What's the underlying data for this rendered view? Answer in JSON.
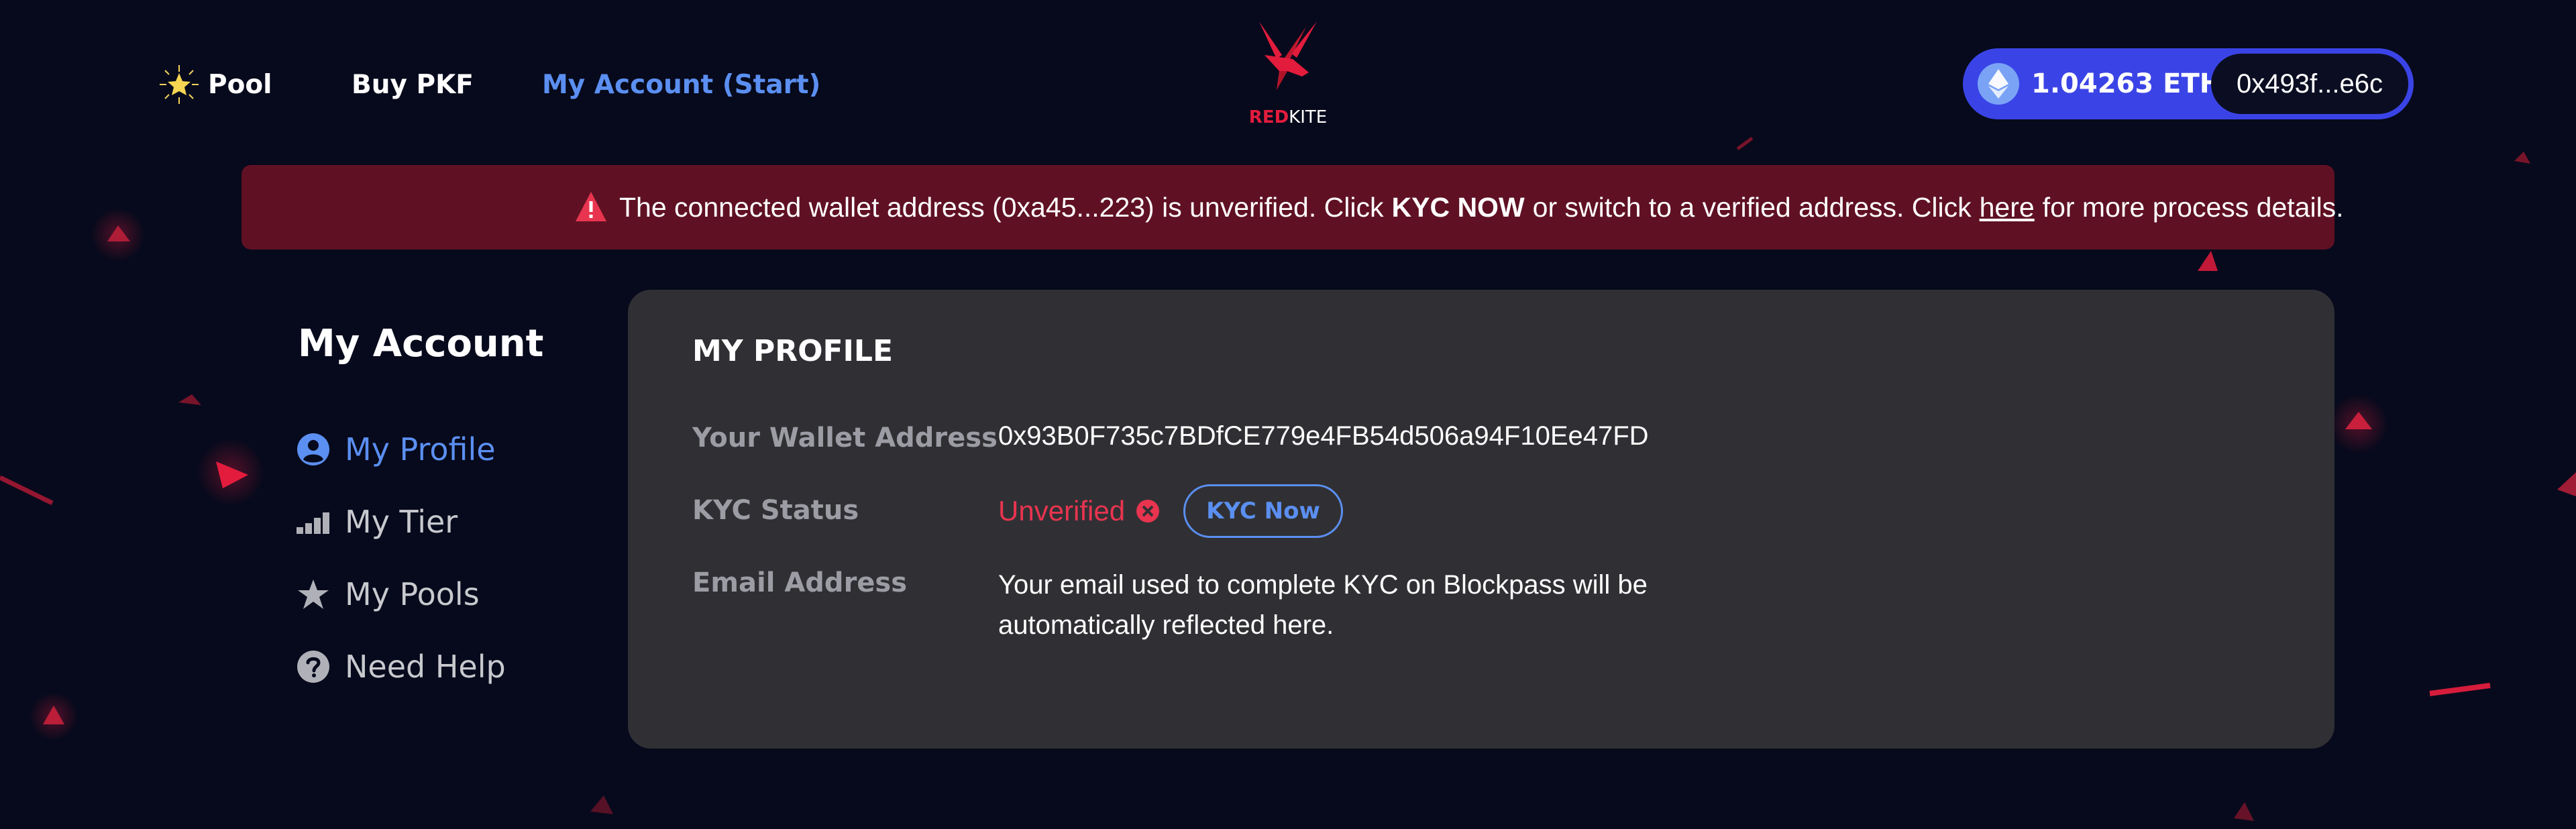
{
  "nav": {
    "pool_label": "Pool",
    "buy_label": "Buy PKF",
    "account_label": "My Account (Start)"
  },
  "logo": {
    "red_text": "RED",
    "kite_text": "KITE"
  },
  "wallet": {
    "balance": "1.04263 ETH",
    "address_short": "0x493f...e6c"
  },
  "alert": {
    "text_before": "The connected wallet address (0xa45...223) is unverified. Click",
    "bold": "KYC NOW",
    "text_middle": "or switch to a verified address. Click",
    "link": "here",
    "text_after": "for more process details."
  },
  "sidebar": {
    "title": "My Account",
    "items": [
      {
        "label": "My Profile",
        "icon": "user-circle-icon",
        "active": true
      },
      {
        "label": "My Tier",
        "icon": "signal-bars-icon",
        "active": false
      },
      {
        "label": "My Pools",
        "icon": "star-icon",
        "active": false
      },
      {
        "label": "Need Help",
        "icon": "question-circle-icon",
        "active": false
      }
    ]
  },
  "profile": {
    "title": "MY PROFILE",
    "wallet_label": "Your Wallet Address",
    "wallet_value": "0x93B0F735c7BDfCE779e4FB54d506a94F10Ee47FD",
    "kyc_label": "KYC Status",
    "kyc_value": "Unverified",
    "kyc_button": "KYC Now",
    "email_label": "Email Address",
    "email_value": "Your email used to complete KYC on Blockpass will be automatically reflected here."
  },
  "colors": {
    "background": "#070a1c",
    "accent_blue": "#5b8ff1",
    "alert_bg": "#5f1123",
    "brand_red": "#e31c3d",
    "card_bg": "#303034",
    "wallet_pill": "#3a44e6"
  }
}
